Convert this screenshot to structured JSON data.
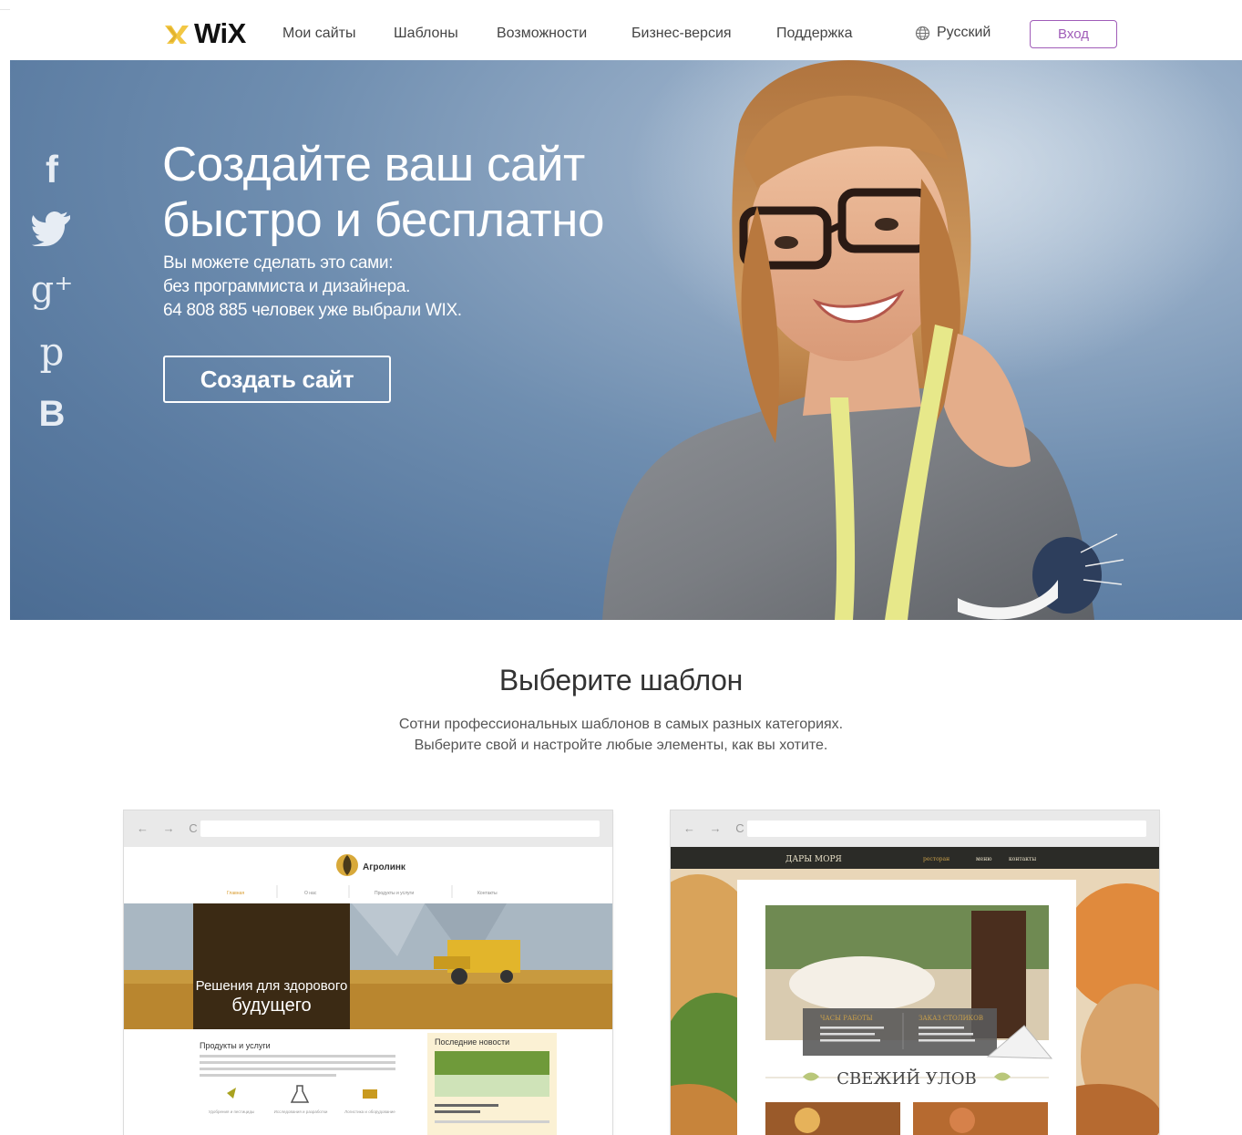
{
  "header": {
    "logo_text": "WiX",
    "nav": [
      "Мои сайты",
      "Шаблоны",
      "Возможности",
      "Бизнес-версия",
      "Поддержка"
    ],
    "language": "Русский",
    "login_label": "Вход"
  },
  "social": {
    "icons": [
      "facebook-icon",
      "twitter-icon",
      "google-plus-icon",
      "pinterest-icon",
      "vkontakte-icon"
    ],
    "glyphs": [
      "f",
      "t",
      "g⁺",
      "p",
      "B"
    ]
  },
  "hero": {
    "title_line1": "Создайте ваш сайт",
    "title_line2": "быстро и бесплатно",
    "sub_line1": "Вы можете сделать это сами:",
    "sub_line2": "без программиста и дизайнера.",
    "sub_line3": "64 808 885 человек уже выбрали WIX.",
    "cta_label": "Создать сайт"
  },
  "templates": {
    "title": "Выберите шаблон",
    "text_line1": "Сотни профессиональных шаблонов в самых разных категориях.",
    "text_line2": "Выберите свой и настройте любые элементы, как вы хотите.",
    "browser_nav": "← → C",
    "agro": {
      "brand": "Агролинк",
      "menu": [
        "Главная",
        "О нас",
        "Продукты и услуги",
        "Контакты"
      ],
      "banner_line1": "Решения для здорового",
      "banner_line2": "будущего",
      "products_title": "Продукты и услуги",
      "news_title": "Последние новости",
      "icons": [
        "Удобрения и пестициды",
        "Исследования и разработки",
        "Логистика и оборудование"
      ]
    },
    "sea": {
      "brand": "ДАРЫ МОРЯ",
      "menu": [
        "ресторан",
        "меню",
        "контакты"
      ],
      "hours_title": "ЧАСЫ РАБОТЫ",
      "booking_title": "ЗАКАЗ СТОЛИКОВ",
      "catch_title": "СВЕЖИЙ УЛОВ"
    }
  },
  "colors": {
    "accent": "#a05cb8",
    "hero_blue": "#5a7ba1"
  }
}
